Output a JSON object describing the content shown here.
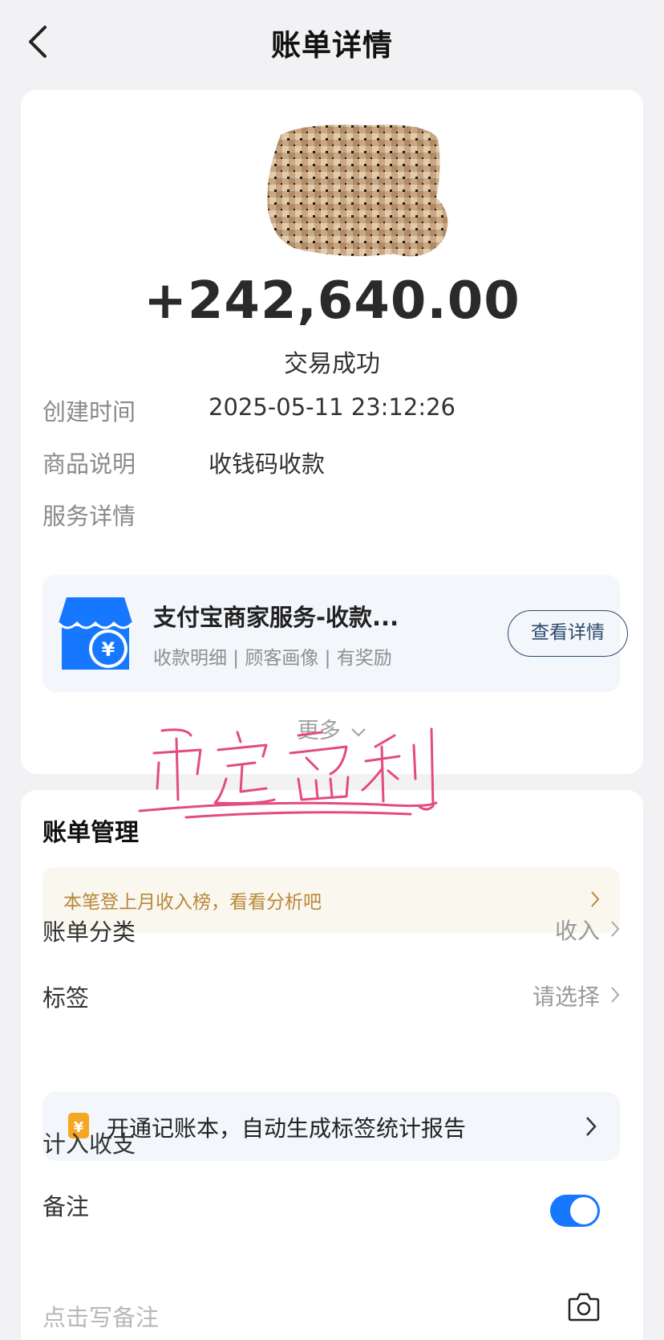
{
  "header": {
    "title": "账单详情",
    "back_icon": "chevron-left-icon"
  },
  "summary": {
    "amount": "+242,640.00",
    "status": "交易成功"
  },
  "info": [
    {
      "label": "创建时间",
      "value": "2025-05-11 23:12:26"
    },
    {
      "label": "商品说明",
      "value": "收钱码收款"
    },
    {
      "label": "服务详情",
      "value": ""
    }
  ],
  "service": {
    "title": "支付宝商家服务-收款...",
    "subtitle": "收款明细 | 顾客画像 | 有奖励",
    "button": "查看详情",
    "icon": "shop-yuan-icon"
  },
  "more": {
    "label": "更多"
  },
  "signature": {
    "text": "币定盈利"
  },
  "management": {
    "title": "账单管理",
    "hint": "本笔登上月收入榜，看看分析吧",
    "category_label": "账单分类",
    "category_value": "收入",
    "tag_label": "标签",
    "tag_value": "请选择",
    "promo": "开通记账本，自动生成标签统计报告",
    "include_label": "计入收支",
    "include_enabled": true,
    "note_label": "备注",
    "note_placeholder": "点击写备注"
  },
  "colors": {
    "accent": "#1677ff",
    "hint_text": "#b8873a",
    "background": "#f2f2f4"
  }
}
